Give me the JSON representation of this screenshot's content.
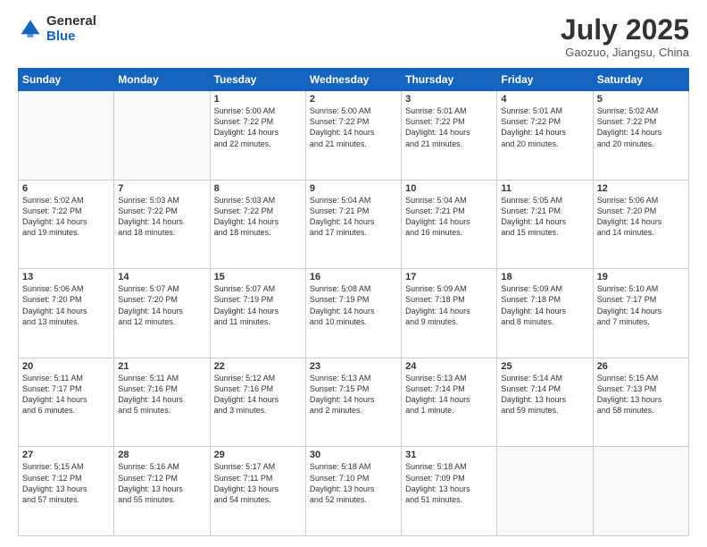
{
  "logo": {
    "general": "General",
    "blue": "Blue"
  },
  "header": {
    "month": "July 2025",
    "location": "Gaozuo, Jiangsu, China"
  },
  "weekdays": [
    "Sunday",
    "Monday",
    "Tuesday",
    "Wednesday",
    "Thursday",
    "Friday",
    "Saturday"
  ],
  "weeks": [
    [
      {
        "day": "",
        "info": ""
      },
      {
        "day": "",
        "info": ""
      },
      {
        "day": "1",
        "info": "Sunrise: 5:00 AM\nSunset: 7:22 PM\nDaylight: 14 hours\nand 22 minutes."
      },
      {
        "day": "2",
        "info": "Sunrise: 5:00 AM\nSunset: 7:22 PM\nDaylight: 14 hours\nand 21 minutes."
      },
      {
        "day": "3",
        "info": "Sunrise: 5:01 AM\nSunset: 7:22 PM\nDaylight: 14 hours\nand 21 minutes."
      },
      {
        "day": "4",
        "info": "Sunrise: 5:01 AM\nSunset: 7:22 PM\nDaylight: 14 hours\nand 20 minutes."
      },
      {
        "day": "5",
        "info": "Sunrise: 5:02 AM\nSunset: 7:22 PM\nDaylight: 14 hours\nand 20 minutes."
      }
    ],
    [
      {
        "day": "6",
        "info": "Sunrise: 5:02 AM\nSunset: 7:22 PM\nDaylight: 14 hours\nand 19 minutes."
      },
      {
        "day": "7",
        "info": "Sunrise: 5:03 AM\nSunset: 7:22 PM\nDaylight: 14 hours\nand 18 minutes."
      },
      {
        "day": "8",
        "info": "Sunrise: 5:03 AM\nSunset: 7:22 PM\nDaylight: 14 hours\nand 18 minutes."
      },
      {
        "day": "9",
        "info": "Sunrise: 5:04 AM\nSunset: 7:21 PM\nDaylight: 14 hours\nand 17 minutes."
      },
      {
        "day": "10",
        "info": "Sunrise: 5:04 AM\nSunset: 7:21 PM\nDaylight: 14 hours\nand 16 minutes."
      },
      {
        "day": "11",
        "info": "Sunrise: 5:05 AM\nSunset: 7:21 PM\nDaylight: 14 hours\nand 15 minutes."
      },
      {
        "day": "12",
        "info": "Sunrise: 5:06 AM\nSunset: 7:20 PM\nDaylight: 14 hours\nand 14 minutes."
      }
    ],
    [
      {
        "day": "13",
        "info": "Sunrise: 5:06 AM\nSunset: 7:20 PM\nDaylight: 14 hours\nand 13 minutes."
      },
      {
        "day": "14",
        "info": "Sunrise: 5:07 AM\nSunset: 7:20 PM\nDaylight: 14 hours\nand 12 minutes."
      },
      {
        "day": "15",
        "info": "Sunrise: 5:07 AM\nSunset: 7:19 PM\nDaylight: 14 hours\nand 11 minutes."
      },
      {
        "day": "16",
        "info": "Sunrise: 5:08 AM\nSunset: 7:19 PM\nDaylight: 14 hours\nand 10 minutes."
      },
      {
        "day": "17",
        "info": "Sunrise: 5:09 AM\nSunset: 7:18 PM\nDaylight: 14 hours\nand 9 minutes."
      },
      {
        "day": "18",
        "info": "Sunrise: 5:09 AM\nSunset: 7:18 PM\nDaylight: 14 hours\nand 8 minutes."
      },
      {
        "day": "19",
        "info": "Sunrise: 5:10 AM\nSunset: 7:17 PM\nDaylight: 14 hours\nand 7 minutes."
      }
    ],
    [
      {
        "day": "20",
        "info": "Sunrise: 5:11 AM\nSunset: 7:17 PM\nDaylight: 14 hours\nand 6 minutes."
      },
      {
        "day": "21",
        "info": "Sunrise: 5:11 AM\nSunset: 7:16 PM\nDaylight: 14 hours\nand 5 minutes."
      },
      {
        "day": "22",
        "info": "Sunrise: 5:12 AM\nSunset: 7:16 PM\nDaylight: 14 hours\nand 3 minutes."
      },
      {
        "day": "23",
        "info": "Sunrise: 5:13 AM\nSunset: 7:15 PM\nDaylight: 14 hours\nand 2 minutes."
      },
      {
        "day": "24",
        "info": "Sunrise: 5:13 AM\nSunset: 7:14 PM\nDaylight: 14 hours\nand 1 minute."
      },
      {
        "day": "25",
        "info": "Sunrise: 5:14 AM\nSunset: 7:14 PM\nDaylight: 13 hours\nand 59 minutes."
      },
      {
        "day": "26",
        "info": "Sunrise: 5:15 AM\nSunset: 7:13 PM\nDaylight: 13 hours\nand 58 minutes."
      }
    ],
    [
      {
        "day": "27",
        "info": "Sunrise: 5:15 AM\nSunset: 7:12 PM\nDaylight: 13 hours\nand 57 minutes."
      },
      {
        "day": "28",
        "info": "Sunrise: 5:16 AM\nSunset: 7:12 PM\nDaylight: 13 hours\nand 55 minutes."
      },
      {
        "day": "29",
        "info": "Sunrise: 5:17 AM\nSunset: 7:11 PM\nDaylight: 13 hours\nand 54 minutes."
      },
      {
        "day": "30",
        "info": "Sunrise: 5:18 AM\nSunset: 7:10 PM\nDaylight: 13 hours\nand 52 minutes."
      },
      {
        "day": "31",
        "info": "Sunrise: 5:18 AM\nSunset: 7:09 PM\nDaylight: 13 hours\nand 51 minutes."
      },
      {
        "day": "",
        "info": ""
      },
      {
        "day": "",
        "info": ""
      }
    ]
  ]
}
